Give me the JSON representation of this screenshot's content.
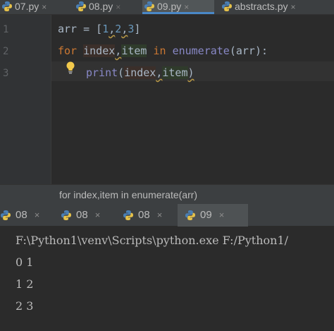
{
  "editor_tabs": [
    {
      "label": "07.py",
      "close": "×"
    },
    {
      "label": "08.py",
      "close": "×"
    },
    {
      "label": "09.py",
      "close": "×"
    },
    {
      "label": "abstracts.py",
      "close": "×"
    }
  ],
  "line_numbers": [
    "1",
    "2",
    "3"
  ],
  "code": {
    "line1": {
      "a": "arr = [",
      "n1": "1",
      "c1": ",",
      "n2": "2",
      "c2": ",",
      "n3": "3",
      "end": "]"
    },
    "line2": {
      "kw_for": "for",
      "sp1": " ",
      "index": "index",
      "comma": ",",
      "item": "item",
      "sp2": " ",
      "kw_in": "in",
      "sp3": " ",
      "builtin": "enumerate",
      "rest": "(arr):"
    },
    "line3": {
      "fn": "print",
      "open": "(",
      "index": "index",
      "comma": ",",
      "item": "item",
      "close": ")"
    }
  },
  "breadcrumb": "for index,item in enumerate(arr)",
  "run_tabs": [
    {
      "label": "08",
      "close": "×"
    },
    {
      "label": "08",
      "close": "×"
    },
    {
      "label": "08",
      "close": "×"
    },
    {
      "label": "09",
      "close": "×"
    }
  ],
  "console": {
    "command": "F:\\Python1\\venv\\Scripts\\python.exe F:/Python1/",
    "output": [
      "0 1",
      "1 2",
      "2 3"
    ]
  },
  "icons": {
    "python_file": "python-file-icon",
    "intention": "lightbulb-icon"
  },
  "colors": {
    "accent": "#4a88c7",
    "keyword": "#cc7832",
    "number": "#6897bb",
    "builtin": "#8888c6"
  }
}
